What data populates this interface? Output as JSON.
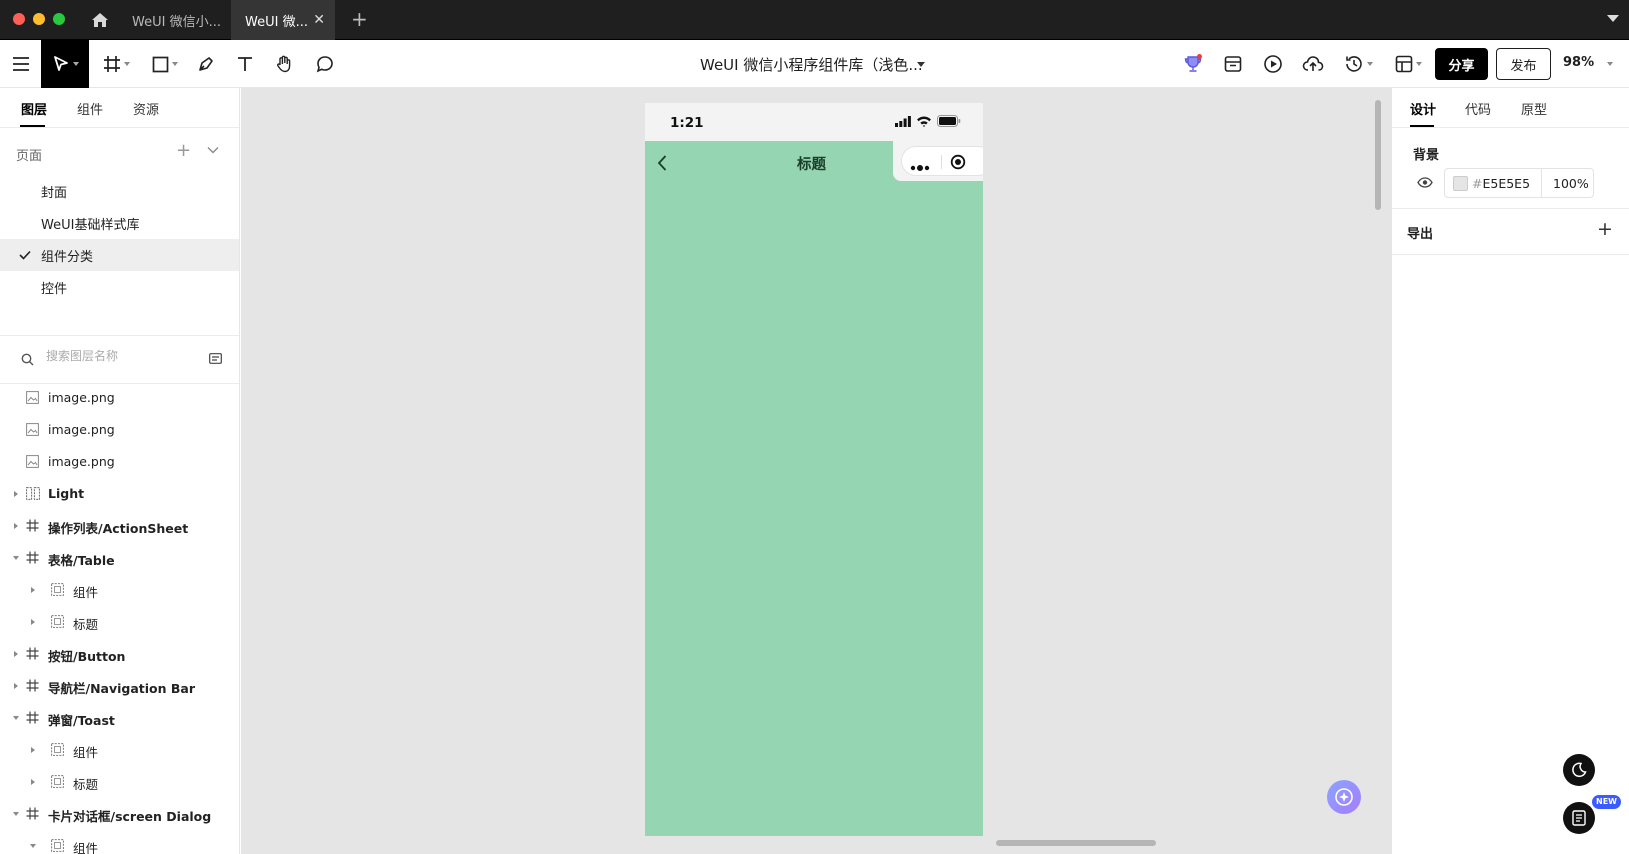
{
  "window": {
    "tabs": [
      {
        "label": "WeUI 微信小..."
      },
      {
        "label": "WeUI 微..."
      }
    ]
  },
  "toolbar": {
    "doc_title": "WeUI 微信小程序组件库（浅色...",
    "share_label": "分享",
    "publish_label": "发布",
    "zoom": "98%"
  },
  "left": {
    "tabs": [
      "图层",
      "组件",
      "资源"
    ],
    "pages_label": "页面",
    "pages": [
      "封面",
      "WeUI基础样式库",
      "组件分类",
      "控件"
    ],
    "selected_page": "组件分类",
    "search_placeholder": "搜索图层名称",
    "layers": [
      {
        "label": "image.png",
        "icon": "image-icon"
      },
      {
        "label": "image.png",
        "icon": "image-icon"
      },
      {
        "label": "image.png",
        "icon": "image-icon"
      },
      {
        "label": "Light",
        "icon": "component-set-icon"
      },
      {
        "label": "操作列表/ActionSheet",
        "icon": "frame-icon"
      },
      {
        "label": "表格/Table",
        "icon": "frame-icon"
      },
      {
        "label": "组件",
        "icon": "group-icon"
      },
      {
        "label": "标题",
        "icon": "group-icon"
      },
      {
        "label": "按钮/Button",
        "icon": "frame-icon"
      },
      {
        "label": "导航栏/Navigation Bar",
        "icon": "frame-icon"
      },
      {
        "label": "弹窗/Toast",
        "icon": "frame-icon"
      },
      {
        "label": "组件",
        "icon": "group-icon"
      },
      {
        "label": "标题",
        "icon": "group-icon"
      },
      {
        "label": "卡片对话框/screen Dialog",
        "icon": "frame-icon"
      },
      {
        "label": "组件",
        "icon": "group-icon"
      }
    ]
  },
  "canvas": {
    "background": "#E5E5E5",
    "phone": {
      "time": "1:21",
      "nav_title": "标题",
      "fill": "#96D5B1"
    }
  },
  "right": {
    "tabs": [
      "设计",
      "代码",
      "原型"
    ],
    "background_label": "背景",
    "hex_prefix": "#",
    "hex_value": "E5E5E5",
    "opacity": "100%",
    "export_label": "导出"
  },
  "fab": {
    "new_badge": "NEW"
  }
}
